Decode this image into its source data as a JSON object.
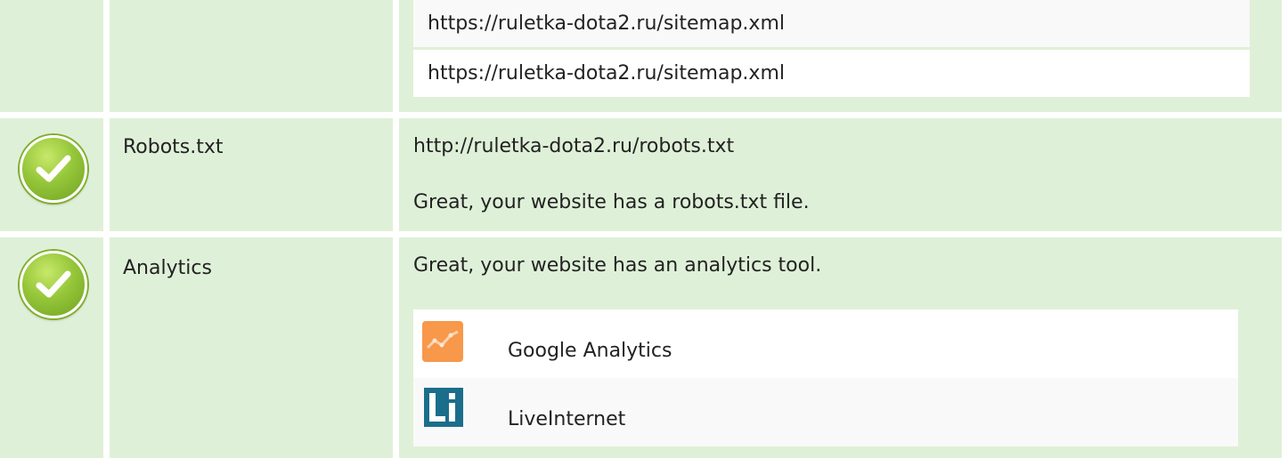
{
  "sitemap_row": {
    "urls": [
      "https://ruletka-dota2.ru/sitemap.xml",
      "https://ruletka-dota2.ru/sitemap.xml"
    ]
  },
  "robots_row": {
    "label": "Robots.txt",
    "url": "http://ruletka-dota2.ru/robots.txt",
    "message": "Great, your website has a robots.txt file.",
    "status_icon": "check-icon"
  },
  "analytics_row": {
    "label": "Analytics",
    "message": "Great, your website has an analytics tool.",
    "status_icon": "check-icon",
    "tools": [
      {
        "name": "Google Analytics",
        "icon": "google-analytics-logo"
      },
      {
        "name": "LiveInternet",
        "icon": "liveinternet-logo"
      }
    ]
  },
  "colors": {
    "row_bg": "#dff0d8",
    "check_green": "#96c73a",
    "ga_orange": "#f7984b",
    "li_blue": "#1b6e8b"
  }
}
